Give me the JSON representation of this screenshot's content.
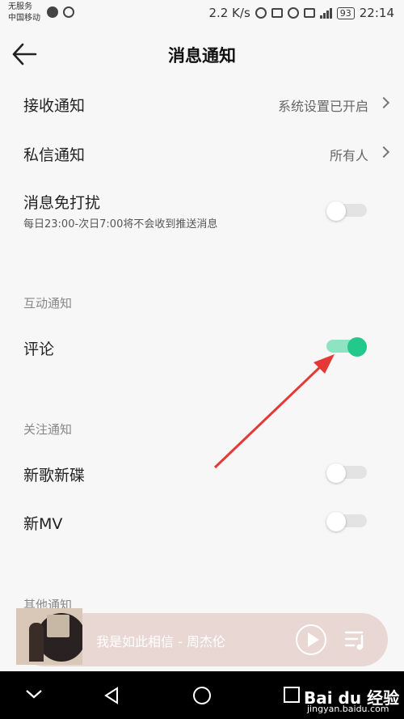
{
  "status_bar": {
    "carrier_line1": "无服务",
    "carrier_line2": "中国移动",
    "speed": "2.2 K/s",
    "battery": "93",
    "time": "22:14"
  },
  "header": {
    "title": "消息通知"
  },
  "settings": {
    "receive": {
      "label": "接收通知",
      "value": "系统设置已开启"
    },
    "private_msg": {
      "label": "私信通知",
      "value": "所有人"
    },
    "dnd": {
      "label": "消息免打扰",
      "sub": "每日23:00-次日7:00将不会收到推送消息",
      "enabled": false
    },
    "interaction_section": "互动通知",
    "comment": {
      "label": "评论",
      "enabled": true
    },
    "follow_section": "关注通知",
    "new_songs": {
      "label": "新歌新碟",
      "enabled": false
    },
    "new_mv": {
      "label": "新MV",
      "enabled": false
    },
    "other_section": "其他通知"
  },
  "player": {
    "title": "我是如此相信 - 周杰伦"
  },
  "watermark": {
    "text": "Bai du 经验",
    "sub": "jingyan.baidu.com"
  },
  "colors": {
    "accent": "#22c98a",
    "toggle_on_track": "#8ee3c2",
    "arrow": "#e53935",
    "player_bg": "#e9d7d3"
  }
}
